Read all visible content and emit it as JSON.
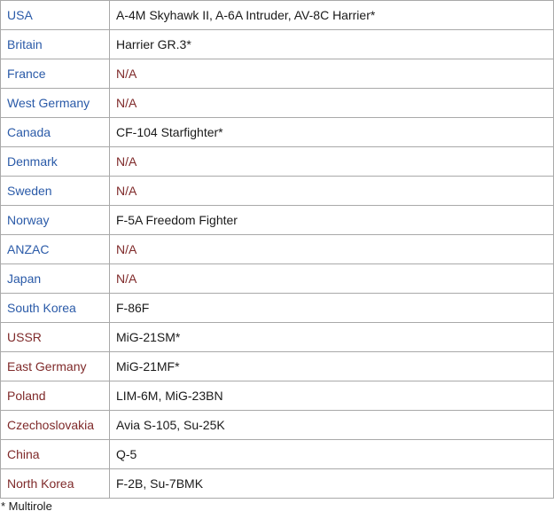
{
  "colors": {
    "western": "#2a5aa8",
    "eastern": "#7f2a2a",
    "text": "#1a1a1a",
    "border": "#a9a9a9"
  },
  "rows": [
    {
      "country": "USA",
      "aircraft": "A-4M Skyhawk II, A-6A Intruder, AV-8C Harrier*",
      "country_color": "blue",
      "aircraft_color": "black"
    },
    {
      "country": "Britain",
      "aircraft": "Harrier GR.3*",
      "country_color": "blue",
      "aircraft_color": "black"
    },
    {
      "country": "France",
      "aircraft": "N/A",
      "country_color": "blue",
      "aircraft_color": "maroon"
    },
    {
      "country": "West Germany",
      "aircraft": "N/A",
      "country_color": "blue",
      "aircraft_color": "maroon"
    },
    {
      "country": "Canada",
      "aircraft": "CF-104 Starfighter*",
      "country_color": "blue",
      "aircraft_color": "black"
    },
    {
      "country": "Denmark",
      "aircraft": "N/A",
      "country_color": "blue",
      "aircraft_color": "maroon"
    },
    {
      "country": "Sweden",
      "aircraft": "N/A",
      "country_color": "blue",
      "aircraft_color": "maroon"
    },
    {
      "country": "Norway",
      "aircraft": "F-5A Freedom Fighter",
      "country_color": "blue",
      "aircraft_color": "black"
    },
    {
      "country": "ANZAC",
      "aircraft": "N/A",
      "country_color": "blue",
      "aircraft_color": "maroon"
    },
    {
      "country": "Japan",
      "aircraft": "N/A",
      "country_color": "blue",
      "aircraft_color": "maroon"
    },
    {
      "country": "South Korea",
      "aircraft": "F-86F",
      "country_color": "blue",
      "aircraft_color": "black"
    },
    {
      "country": "USSR",
      "aircraft": "MiG-21SM*",
      "country_color": "maroon",
      "aircraft_color": "black"
    },
    {
      "country": "East Germany",
      "aircraft": "MiG-21MF*",
      "country_color": "maroon",
      "aircraft_color": "black"
    },
    {
      "country": "Poland",
      "aircraft": "LIM-6M, MiG-23BN",
      "country_color": "maroon",
      "aircraft_color": "black"
    },
    {
      "country": "Czechoslovakia",
      "aircraft": "Avia S-105, Su-25K",
      "country_color": "maroon",
      "aircraft_color": "black"
    },
    {
      "country": "China",
      "aircraft": "Q-5",
      "country_color": "maroon",
      "aircraft_color": "black"
    },
    {
      "country": "North Korea",
      "aircraft": "F-2B, Su-7BMK",
      "country_color": "maroon",
      "aircraft_color": "black"
    }
  ],
  "footnote": "* Multirole"
}
